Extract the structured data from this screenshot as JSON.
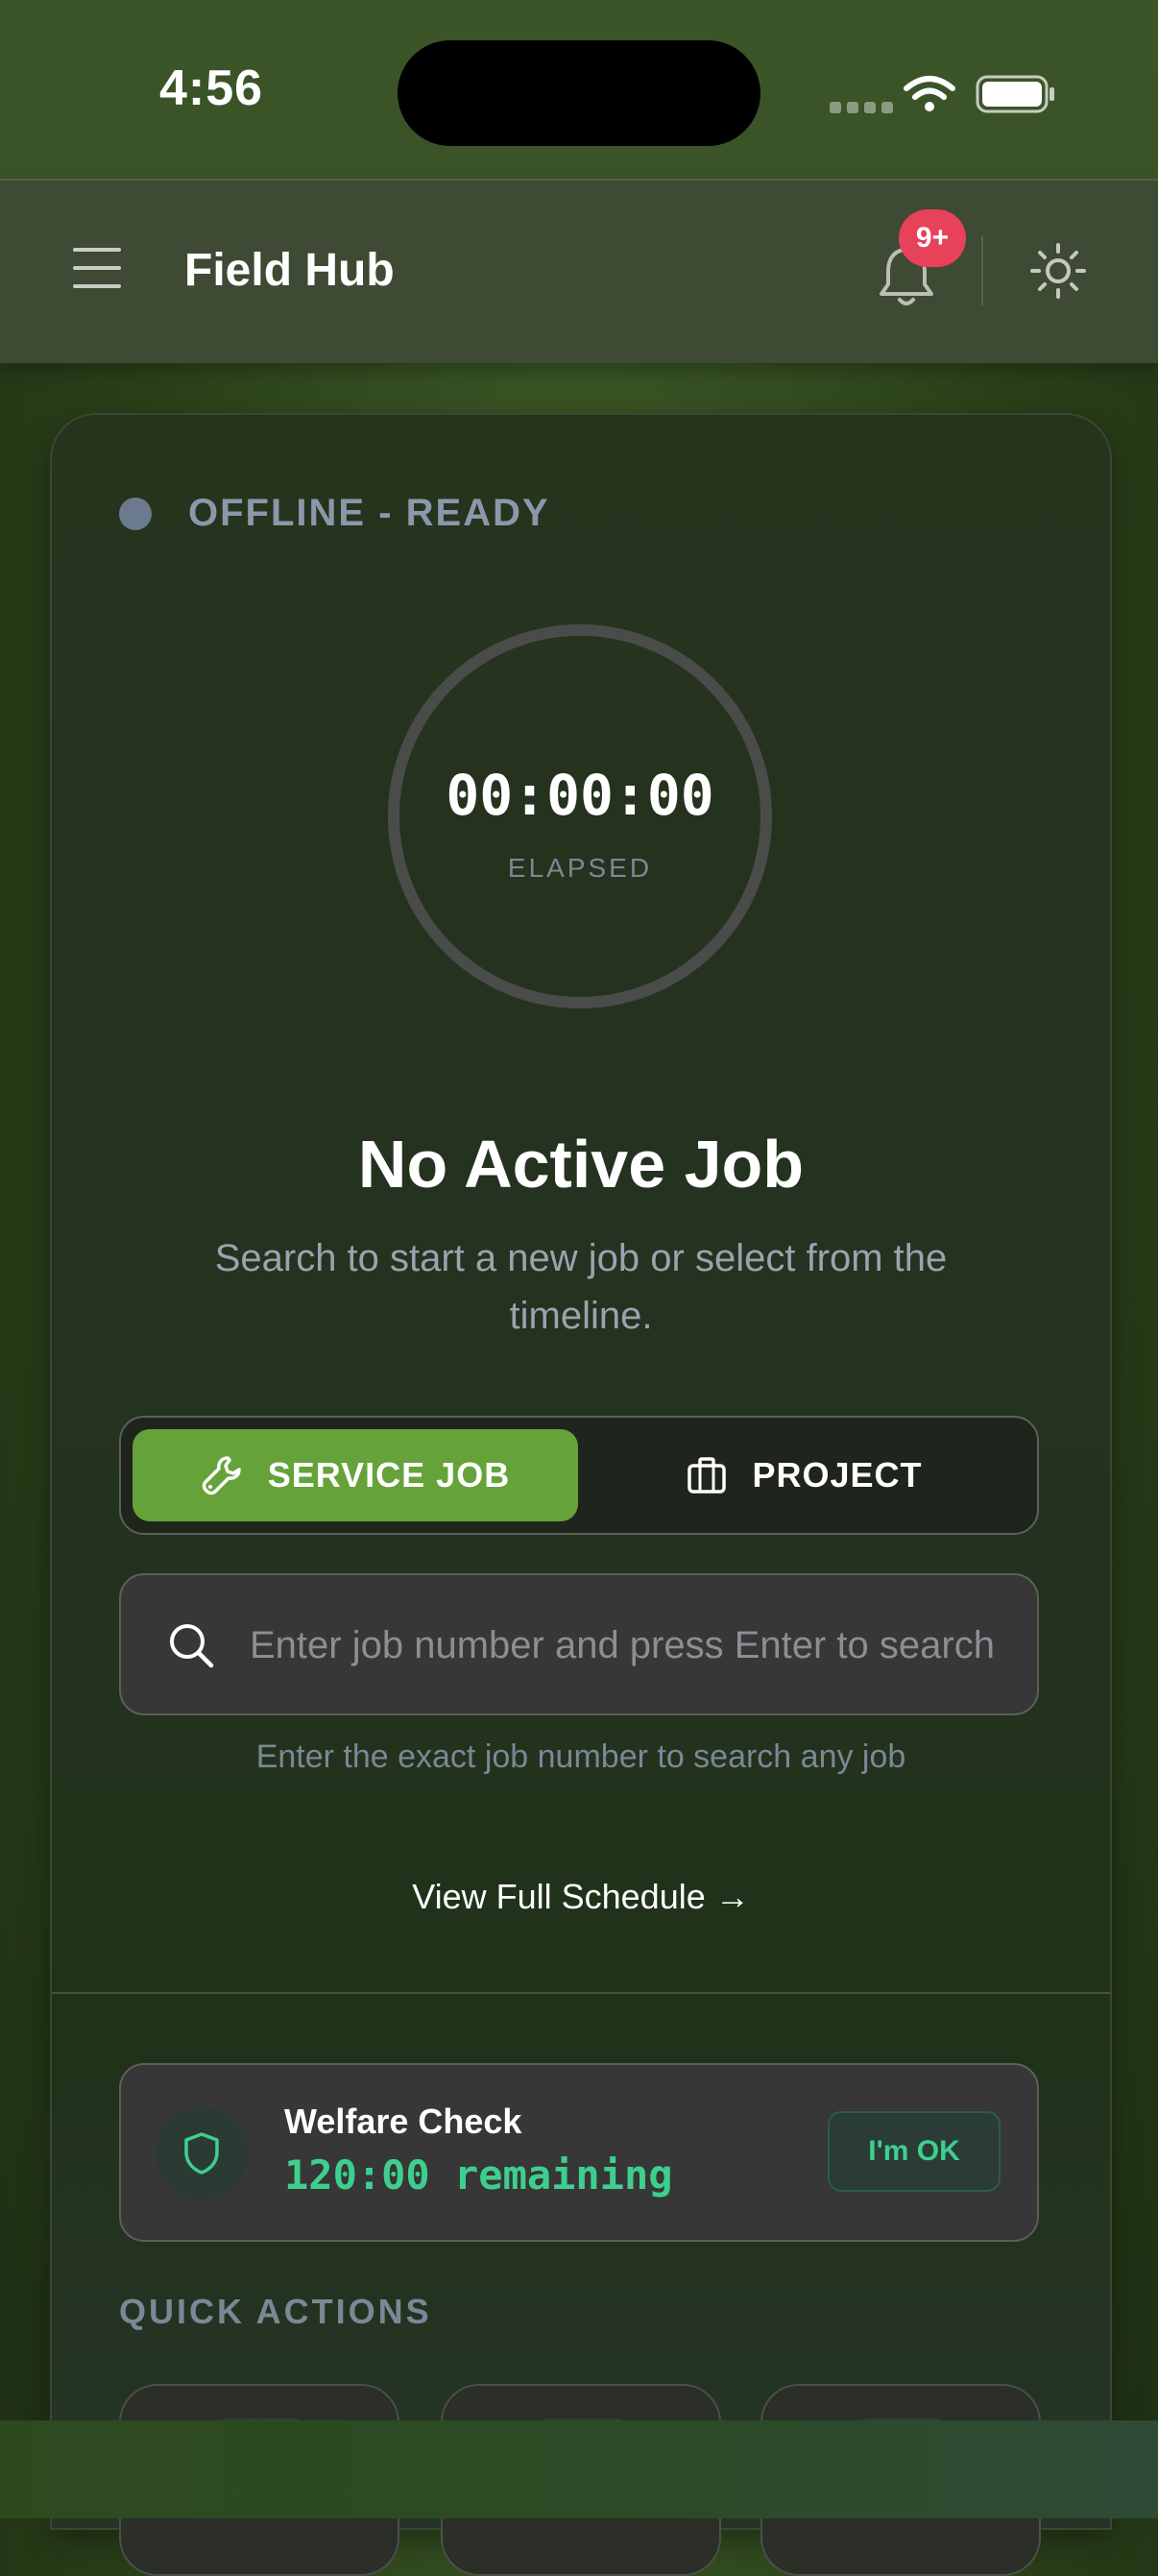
{
  "status_bar": {
    "time": "4:56"
  },
  "header": {
    "title": "Field Hub",
    "notification_badge": "9+"
  },
  "connection": {
    "status": "OFFLINE - READY"
  },
  "timer": {
    "value": "00:00:00",
    "label": "ELAPSED"
  },
  "job": {
    "title": "No Active Job",
    "subtitle": "Search to start a new job or select from the timeline."
  },
  "job_type": {
    "options": [
      "SERVICE JOB",
      "PROJECT"
    ],
    "selected": "SERVICE JOB"
  },
  "search": {
    "placeholder": "Enter job number and press Enter to search",
    "value": "",
    "hint": "Enter the exact job number to search any job"
  },
  "schedule_link": "View Full Schedule →",
  "welfare": {
    "title": "Welfare Check",
    "remaining": "120:00 remaining",
    "button": "I'm OK"
  },
  "quick_actions": {
    "title": "QUICK ACTIONS"
  },
  "icons": {
    "menu": "hamburger-menu-icon",
    "notifications": "bell-icon",
    "theme": "sun-icon",
    "service": "wrench-icon",
    "project": "briefcase-icon",
    "search": "search-icon",
    "welfare": "shield-icon"
  },
  "colors": {
    "accent_green": "#65a33a",
    "badge_red": "#e8415a",
    "welfare_green": "#3ecf8e",
    "offline_dot": "#6b7a8e"
  }
}
